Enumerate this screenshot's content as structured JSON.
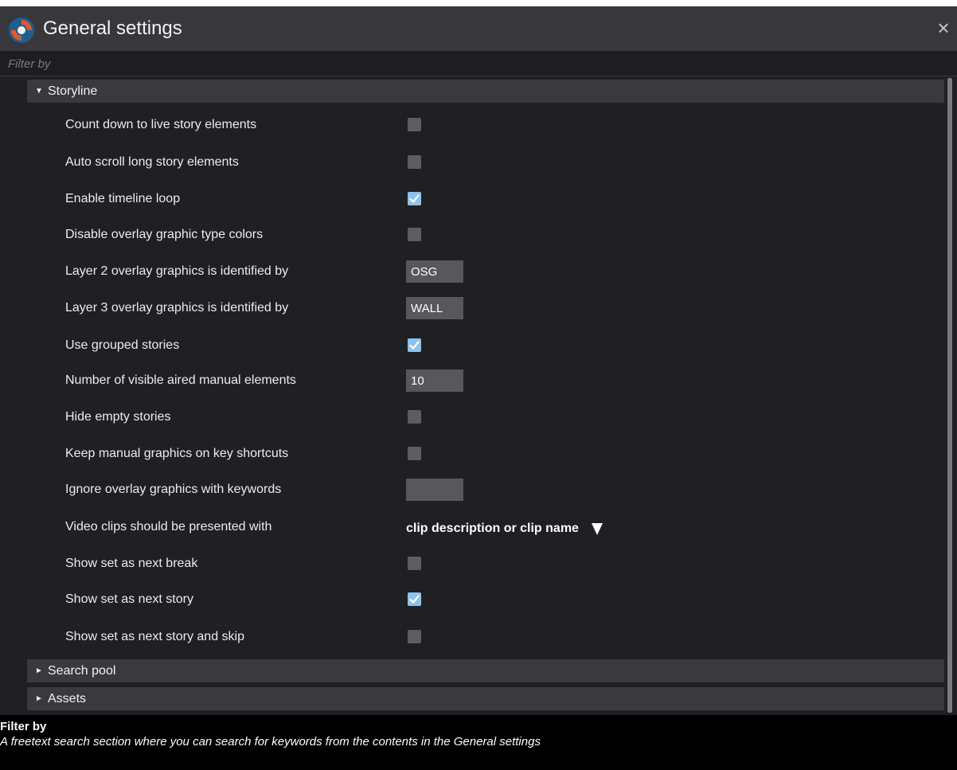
{
  "window": {
    "title": "General settings",
    "close_glyph": "×",
    "logo_icon": "refresh-circle-logo-icon"
  },
  "filter": {
    "placeholder": "Filter by",
    "value": ""
  },
  "sections": [
    {
      "label": "Storyline",
      "expanded": true,
      "settings": [
        {
          "label": "Count down to live story elements",
          "type": "checkbox",
          "checked": false
        },
        {
          "label": "Auto scroll long story elements",
          "type": "checkbox",
          "checked": false
        },
        {
          "label": "Enable timeline loop",
          "type": "checkbox",
          "checked": true
        },
        {
          "label": "Disable overlay graphic type colors",
          "type": "checkbox",
          "checked": false
        },
        {
          "label": "Layer 2 overlay graphics is identified by",
          "type": "text",
          "value": "OSG"
        },
        {
          "label": "Layer 3 overlay graphics is identified by",
          "type": "text",
          "value": "WALL"
        },
        {
          "label": "Use grouped stories",
          "type": "checkbox",
          "checked": true
        },
        {
          "label": "Number of visible aired manual elements",
          "type": "text",
          "value": "10"
        },
        {
          "label": "Hide empty stories",
          "type": "checkbox",
          "checked": false
        },
        {
          "label": "Keep manual graphics on key shortcuts",
          "type": "checkbox",
          "checked": false
        },
        {
          "label": "Ignore overlay graphics with keywords",
          "type": "text",
          "value": ""
        },
        {
          "label": "Video clips should be presented with",
          "type": "select",
          "value": "clip description or clip name"
        },
        {
          "label": "Show set as next break",
          "type": "checkbox",
          "checked": false
        },
        {
          "label": "Show set as next story",
          "type": "checkbox",
          "checked": true
        },
        {
          "label": "Show set as next story and skip",
          "type": "checkbox",
          "checked": false
        }
      ]
    },
    {
      "label": "Search pool",
      "expanded": false
    },
    {
      "label": "Assets",
      "expanded": false
    }
  ],
  "help": {
    "heading": "Filter by",
    "description": "A freetext search section where you can search for keywords from the contents in the General settings"
  },
  "colors": {
    "accent_checked": "#8ec2ee",
    "logo_orange": "#e4572e",
    "logo_blue": "#1e5f8e"
  }
}
